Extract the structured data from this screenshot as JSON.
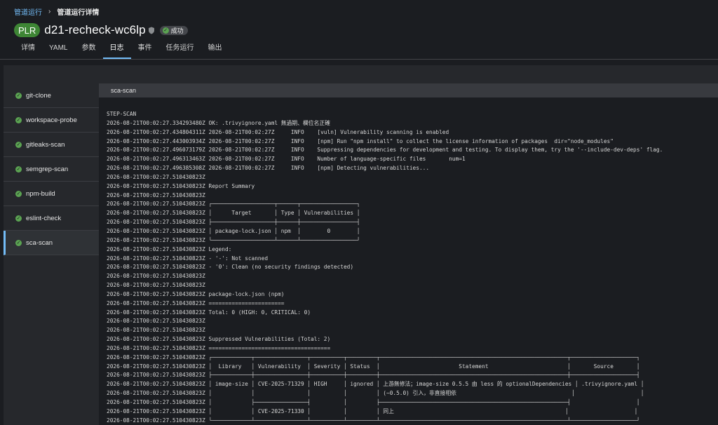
{
  "breadcrumb": {
    "parent": "管道运行",
    "separator": "›",
    "current": "管道运行详情"
  },
  "header": {
    "badge": "PLR",
    "run_name": "d21-recheck-wc6lp",
    "status_icon": "check-circle-icon",
    "status": "成功"
  },
  "tabs": [
    {
      "label": "详情",
      "active": false
    },
    {
      "label": "YAML",
      "active": false
    },
    {
      "label": "参数",
      "active": false
    },
    {
      "label": "日志",
      "active": true
    },
    {
      "label": "事件",
      "active": false
    },
    {
      "label": "任务运行",
      "active": false
    },
    {
      "label": "输出",
      "active": false
    }
  ],
  "steps": [
    {
      "label": "git-clone",
      "status": "succeeded"
    },
    {
      "label": "workspace-probe",
      "status": "succeeded"
    },
    {
      "label": "gitleaks-scan",
      "status": "succeeded"
    },
    {
      "label": "semgrep-scan",
      "status": "succeeded"
    },
    {
      "label": "npm-build",
      "status": "succeeded"
    },
    {
      "label": "eslint-check",
      "status": "succeeded"
    },
    {
      "label": "sca-scan",
      "status": "succeeded",
      "active": true
    }
  ],
  "log": {
    "title": "sca-scan",
    "lines": [
      "STEP-SCAN",
      "2026-08-21T00:02:27.334293480Z OK: .trivyignore.yaml 無過期、欄位名正確",
      "2026-08-21T00:02:27.434804311Z 2026-08-21T00:02:27Z     INFO    [vuln] Vulnerability scanning is enabled",
      "2026-08-21T00:02:27.443003934Z 2026-08-21T00:02:27Z     INFO    [npm] Run \"npm install\" to collect the license information of packages  dir=\"node_modules\"",
      "2026-08-21T00:02:27.496073179Z 2026-08-21T00:02:27Z     INFO    Suppressing dependencies for development and testing. To display them, try the '--include-dev-deps' flag.",
      "2026-08-21T00:02:27.496313463Z 2026-08-21T00:02:27Z     INFO    Number of language-specific files       num=1",
      "2026-08-21T00:02:27.496385308Z 2026-08-21T00:02:27Z     INFO    [npm] Detecting vulnerabilities...",
      "2026-08-21T00:02:27.510430823Z",
      "2026-08-21T00:02:27.510430823Z Report Summary",
      "2026-08-21T00:02:27.510430823Z",
      "2026-08-21T00:02:27.510430823Z ┌───────────────────┬──────┬─────────────────┐",
      "2026-08-21T00:02:27.510430823Z │      Target       │ Type │ Vulnerabilities │",
      "2026-08-21T00:02:27.510430823Z ├───────────────────┼──────┼─────────────────┤",
      "2026-08-21T00:02:27.510430823Z │ package-lock.json │ npm  │        0        │",
      "2026-08-21T00:02:27.510430823Z └───────────────────┴──────┴─────────────────┘",
      "2026-08-21T00:02:27.510430823Z Legend:",
      "2026-08-21T00:02:27.510430823Z - '-': Not scanned",
      "2026-08-21T00:02:27.510430823Z - '0': Clean (no security findings detected)",
      "2026-08-21T00:02:27.510430823Z",
      "2026-08-21T00:02:27.510430823Z",
      "2026-08-21T00:02:27.510430823Z package-lock.json (npm)",
      "2026-08-21T00:02:27.510430823Z =======================",
      "2026-08-21T00:02:27.510430823Z Total: 0 (HIGH: 0, CRITICAL: 0)",
      "2026-08-21T00:02:27.510430823Z",
      "2026-08-21T00:02:27.510430823Z",
      "2026-08-21T00:02:27.510430823Z Suppressed Vulnerabilities (Total: 2)",
      "2026-08-21T00:02:27.510430823Z =====================================",
      "2026-08-21T00:02:27.510430823Z ┌────────────┬────────────────┬──────────┬─────────┬─────────────────────────────────────────────────────────┬────────────────────┐",
      "2026-08-21T00:02:27.510430823Z │  Library   │ Vulnerability  │ Severity │ Status  │                        Statement                        │       Source       │",
      "2026-08-21T00:02:27.510430823Z ├────────────┼────────────────┼──────────┼─────────┼─────────────────────────────────────────────────────────┼────────────────────┤",
      "2026-08-21T00:02:27.510430823Z │ image-size │ CVE-2025-71329 │ HIGH     │ ignored │ 上游無修法；image-size 0.5.5 由 less 的 optionalDependencies │ .trivyignore.yaml │",
      "2026-08-21T00:02:27.510430823Z │            │                │          │         │ (~0.5.0) 引入，非直接相依                                   │                    │",
      "2026-08-21T00:02:27.510430823Z │            ├────────────────┤          │         ├─────────────────────────────────────────────────────────┤                    │",
      "2026-08-21T00:02:27.510430823Z │            │ CVE-2025-71330 │          │         │ 同上                                                    │                    │",
      "2026-08-21T00:02:27.510430823Z └────────────┴────────────────┴──────────┴─────────┴─────────────────────────────────────────────────────────┴────────────────────┘"
    ]
  },
  "colors": {
    "background": "#1b1d21",
    "link": "#73bcf7",
    "success": "#3e8635",
    "success_icon": "#5ba352",
    "panel": "#26282c",
    "log_header": "#383a3f"
  }
}
